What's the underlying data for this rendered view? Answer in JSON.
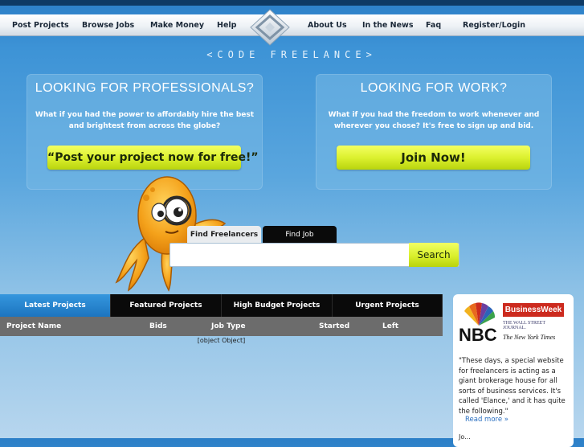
{
  "nav": {
    "items": [
      "Post Projects",
      "Browse Jobs",
      "Make Money",
      "Help",
      "About Us",
      "In the News",
      "Faq",
      "Register/Login"
    ]
  },
  "brand": "<CODE FREELANCE>",
  "panels": {
    "left": {
      "title": "LOOKING FOR PROFESSIONALS?",
      "text": "What if you had the power to affordably hire the best and brightest from across the globe?",
      "cta": "“Post your project now for free!”"
    },
    "right": {
      "title": "LOOKING FOR WORK?",
      "text": "What if you had the freedom to work whenever and wherever you chose? It's free to sign up and bid.",
      "cta": "Join Now!"
    }
  },
  "search": {
    "tabs": [
      "Find Freelancers",
      "Find Job"
    ],
    "active_tab": "Find Freelancers",
    "input_value": "",
    "button": "Search"
  },
  "projects": {
    "tabs": [
      "Latest Projects",
      "Featured Projects",
      "High Budget Projects",
      "Urgent Projects"
    ],
    "active_tab": "Latest Projects",
    "columns": [
      "Project Name",
      "Bids",
      "Job Type",
      "Started",
      "Left"
    ],
    "empty_text": "[object Object]"
  },
  "press": {
    "logos": [
      "NBC",
      "BusinessWeek",
      "THE WALL STREET JOURNAL.",
      "The New York Times"
    ],
    "quote": "\"These days, a special website for freelancers is acting as a giant brokerage house for all sorts of business services. It's called 'Elance,' and it has quite the following.\"",
    "read_more": "Read more »",
    "more_cut": "Jo..."
  },
  "colors": {
    "accent_yellow": "#dcf12f",
    "nav_dark": "#0e3a64",
    "tab_active": "#1c74bf",
    "table_head": "#6c6c6c",
    "nbc_red": "#cc2a1e"
  }
}
